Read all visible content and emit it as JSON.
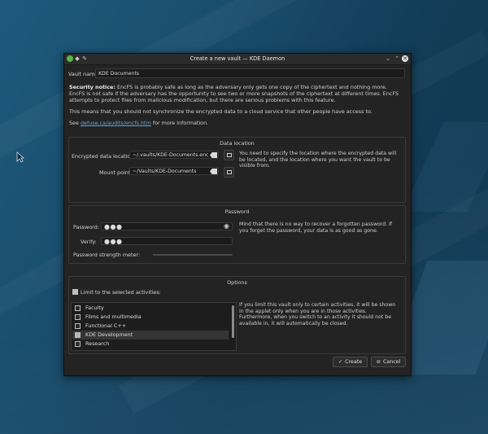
{
  "window": {
    "title": "Create a new vault — KDE Daemon",
    "pin_icon": "pin-icon",
    "colors": {
      "titlebar": "#2b2b2b",
      "body": "#232323",
      "accent": "#5fa7e0"
    }
  },
  "vault_name": {
    "label": "Vault name",
    "value": "KDE Documents"
  },
  "notice": {
    "bold": "Security notice:",
    "text": " EncFS is probably safe as long as the adversary only gets one copy of the ciphertext and nothing more. EncFS is not safe if the adversary has the opportunity to see two or more snapshots of the ciphertext at different times. EncFS attempts to protect files from malicious modification, but there are serious problems with this feature.",
    "sync_warning": "This means that you should not synchronize the encrypted data to a cloud service that other people have access to.",
    "see_prefix": "See ",
    "link": "defuse.ca/audits/encfs.htm",
    "see_suffix": " for more information."
  },
  "data_location": {
    "title": "Data location",
    "encrypted_label": "Encrypted data location",
    "encrypted_value": "~/.vaults/KDE-Documents.enc",
    "mount_label": "Mount point",
    "mount_value": "~/Vaults/KDE-Documents",
    "help": "You need to specify the location where the encrypted data will be located, and the location where you want the vault to be visible from."
  },
  "password": {
    "title": "Password",
    "password_label": "Password:",
    "password_value": "●●●",
    "verify_label": "Verify:",
    "verify_value": "●●●",
    "strength_label": "Password strength meter:",
    "strength": 0.0,
    "help": "Mind that there is no way to recover a forgotten password. If you forget the password, your data is as good as gone."
  },
  "options": {
    "title": "Options",
    "limit_label": "Limit to the selected activities:",
    "limit_checked": true,
    "activities": [
      {
        "label": "Faculty",
        "checked": false,
        "selected": false
      },
      {
        "label": "Films and multimedia",
        "checked": false,
        "selected": false
      },
      {
        "label": "Functional C++",
        "checked": false,
        "selected": false
      },
      {
        "label": "KDE Development",
        "checked": true,
        "selected": true
      },
      {
        "label": "Research",
        "checked": false,
        "selected": false
      }
    ],
    "help": "If you limit this vault only to certain activities, it will be shown in the applet only when you are in those activities. Furthermore, when you switch to an activity it should not be available in, it will automatically be closed."
  },
  "buttons": {
    "create": "Create",
    "cancel": "Cancel"
  }
}
